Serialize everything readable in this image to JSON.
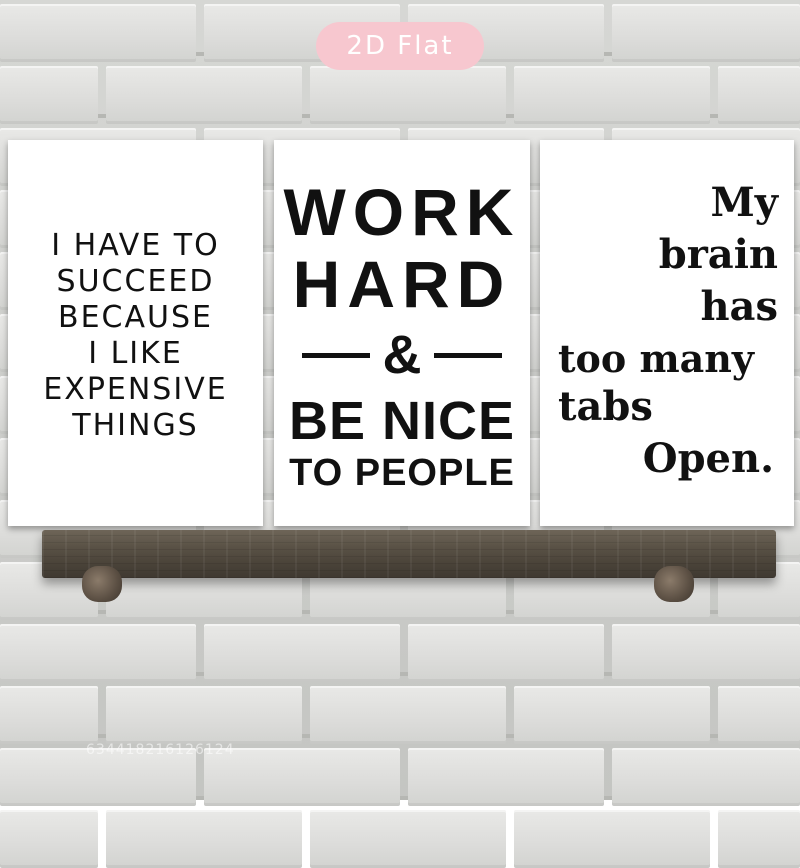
{
  "tag": {
    "label": "2D Flat",
    "color": "#f7c7cf"
  },
  "posters": {
    "left": {
      "lines": [
        "I HAVE TO",
        "SUCCEED",
        "BECAUSE",
        "I LIKE",
        "EXPENSIVE",
        "THINGS"
      ]
    },
    "center": {
      "work": "WORK",
      "hard": "HARD",
      "amp": "&",
      "be_nice": "BE NICE",
      "to_people": "TO PEOPLE"
    },
    "right": {
      "lines": [
        "My",
        "brain",
        "has",
        "too many",
        "tabs",
        "Open."
      ]
    }
  },
  "watermark": "634418216126124",
  "colors": {
    "wall": "#d6d7d4",
    "poster_bg": "#ffffff",
    "text": "#111111",
    "shelf": "#5a5246"
  }
}
